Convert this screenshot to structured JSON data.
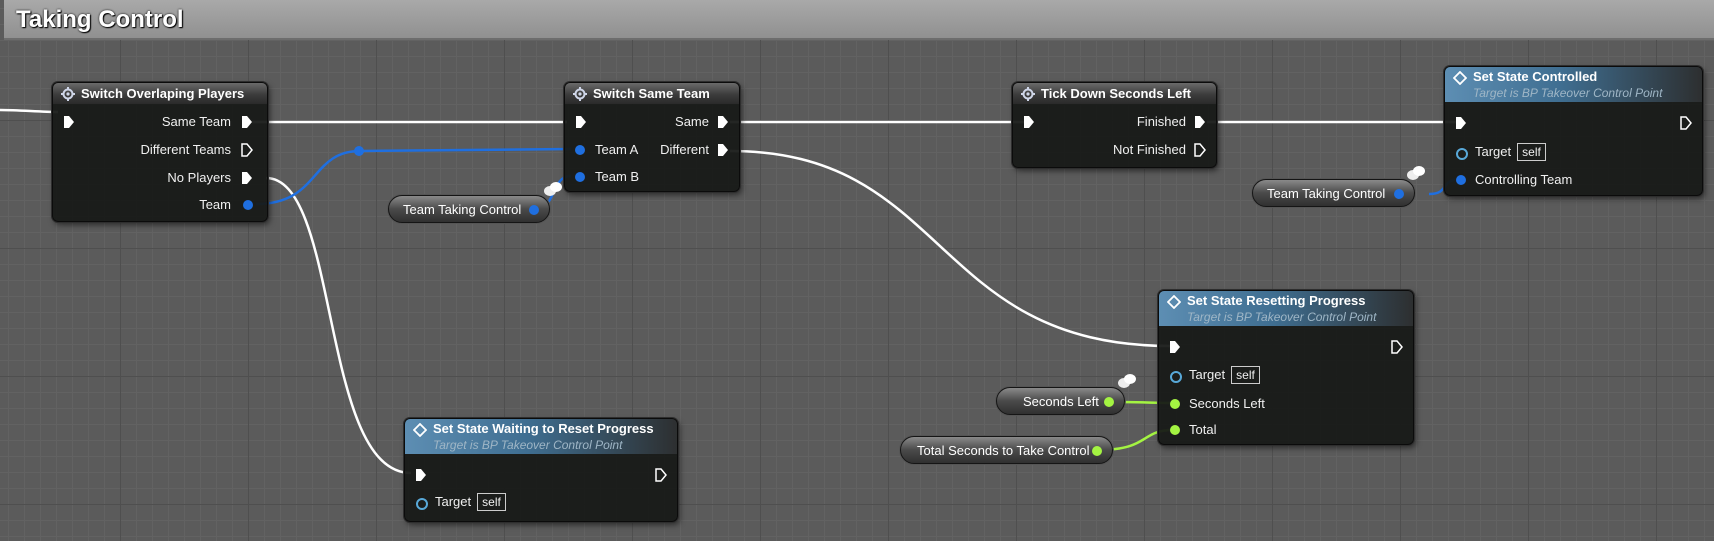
{
  "comment": {
    "title": "Taking Control"
  },
  "nodes": {
    "switch_overlapping": {
      "title": "Switch Overlaping Players",
      "outputs": [
        "Same Team",
        "Different Teams",
        "No Players",
        "Team"
      ]
    },
    "switch_same_team": {
      "title": "Switch Same Team",
      "inputs": [
        "Team A",
        "Team B"
      ],
      "outputs": [
        "Same",
        "Different"
      ]
    },
    "tick_down": {
      "title": "Tick Down Seconds Left",
      "outputs": [
        "Finished",
        "Not Finished"
      ]
    },
    "set_controlled": {
      "title": "Set State Controlled",
      "subtitle": "Target is BP Takeover Control Point",
      "target_label": "Target",
      "target_value": "self",
      "team_label": "Controlling Team"
    },
    "set_resetting": {
      "title": "Set State Resetting Progress",
      "subtitle": "Target is BP Takeover Control Point",
      "target_label": "Target",
      "target_value": "self",
      "seconds_label": "Seconds Left",
      "total_label": "Total"
    },
    "set_waiting": {
      "title": "Set State Waiting to Reset Progress",
      "subtitle": "Target is BP Takeover Control Point",
      "target_label": "Target",
      "target_value": "self"
    }
  },
  "variables": {
    "team_taking_control_1": "Team Taking Control",
    "team_taking_control_2": "Team Taking Control",
    "seconds_left": "Seconds Left",
    "total_seconds": "Total Seconds to Take Control"
  },
  "colors": {
    "exec_wire": "#ffffff",
    "team_wire": "#1f6fe0",
    "float_wire": "#a4f442",
    "function_header": "#4a7aa0"
  }
}
